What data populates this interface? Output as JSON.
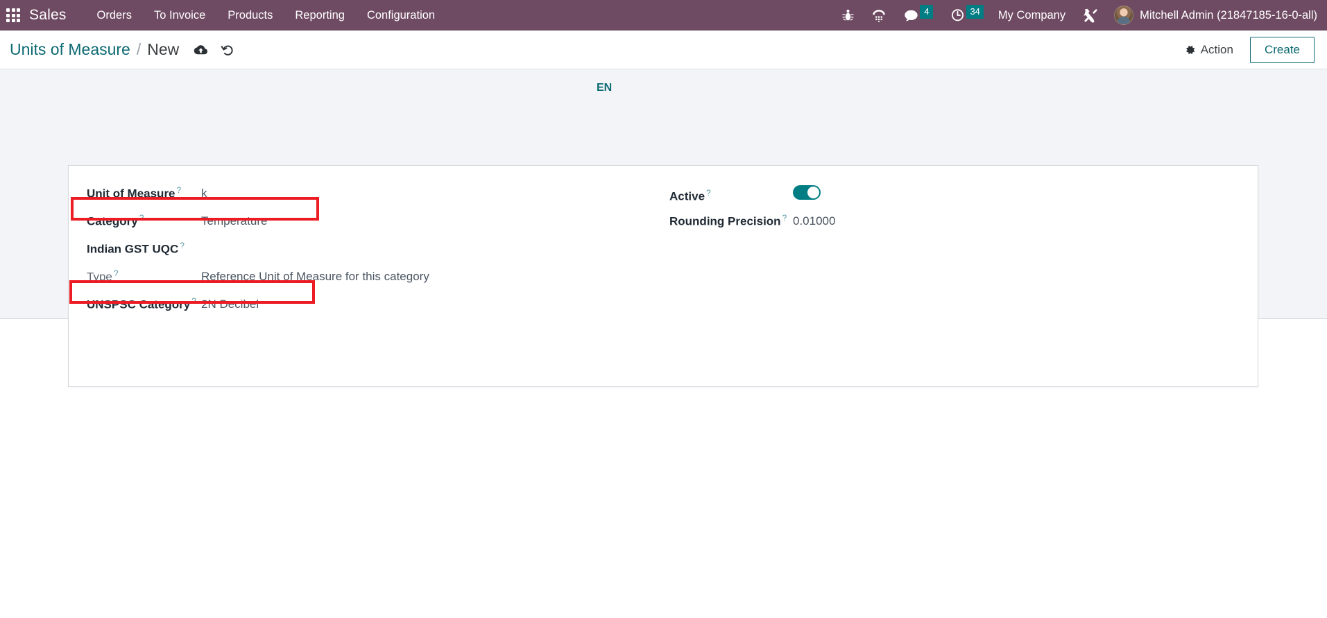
{
  "navbar": {
    "apps_icon": "apps-grid-icon",
    "brand": "Sales",
    "menu": [
      {
        "label": "Orders"
      },
      {
        "label": "To Invoice"
      },
      {
        "label": "Products"
      },
      {
        "label": "Reporting"
      },
      {
        "label": "Configuration"
      }
    ],
    "icons": [
      {
        "name": "bug-icon"
      },
      {
        "name": "dialpad-icon"
      }
    ],
    "messages": {
      "icon": "chat-bubble-icon",
      "count": "4"
    },
    "activities": {
      "icon": "clock-icon",
      "count": "34"
    },
    "company": "My Company",
    "tools_icon": "tools-icon",
    "user": "Mitchell Admin (21847185-16-0-all)",
    "badge_color": "#017E84",
    "bar_color": "#6F4B63"
  },
  "control_panel": {
    "breadcrumb_root": "Units of Measure",
    "breadcrumb_sep": "/",
    "breadcrumb_current": "New",
    "save_icon": "cloud-upload-icon",
    "discard_icon": "undo-icon",
    "action_label": "Action",
    "action_icon": "gear-icon",
    "create_label": "Create",
    "accent_color": "#0C6A72"
  },
  "form": {
    "language_badge": "EN",
    "left_fields": [
      {
        "label": "Unit of Measure",
        "help": "?",
        "value": "k",
        "muted": false
      },
      {
        "label": "Category",
        "help": "?",
        "value": "Temperature",
        "muted": false
      },
      {
        "label": "Indian GST UQC",
        "help": "?",
        "value": "",
        "muted": false
      },
      {
        "label": "Type",
        "help": "?",
        "value": "Reference Unit of Measure for this category",
        "muted": true
      },
      {
        "label": "UNSPSC Category",
        "help": "?",
        "value": "2N Decibel",
        "muted": false
      }
    ],
    "right_fields": [
      {
        "label": "Active",
        "help": "?",
        "value": "",
        "widget": "toggle",
        "toggle_on": true
      },
      {
        "label": "Rounding Precision",
        "help": "?",
        "value": "0.01000",
        "widget": "text"
      }
    ],
    "highlight_color": "#EC1C24",
    "highlights": [
      {
        "name": "category-highlight"
      },
      {
        "name": "unspsc-category-highlight"
      }
    ]
  }
}
